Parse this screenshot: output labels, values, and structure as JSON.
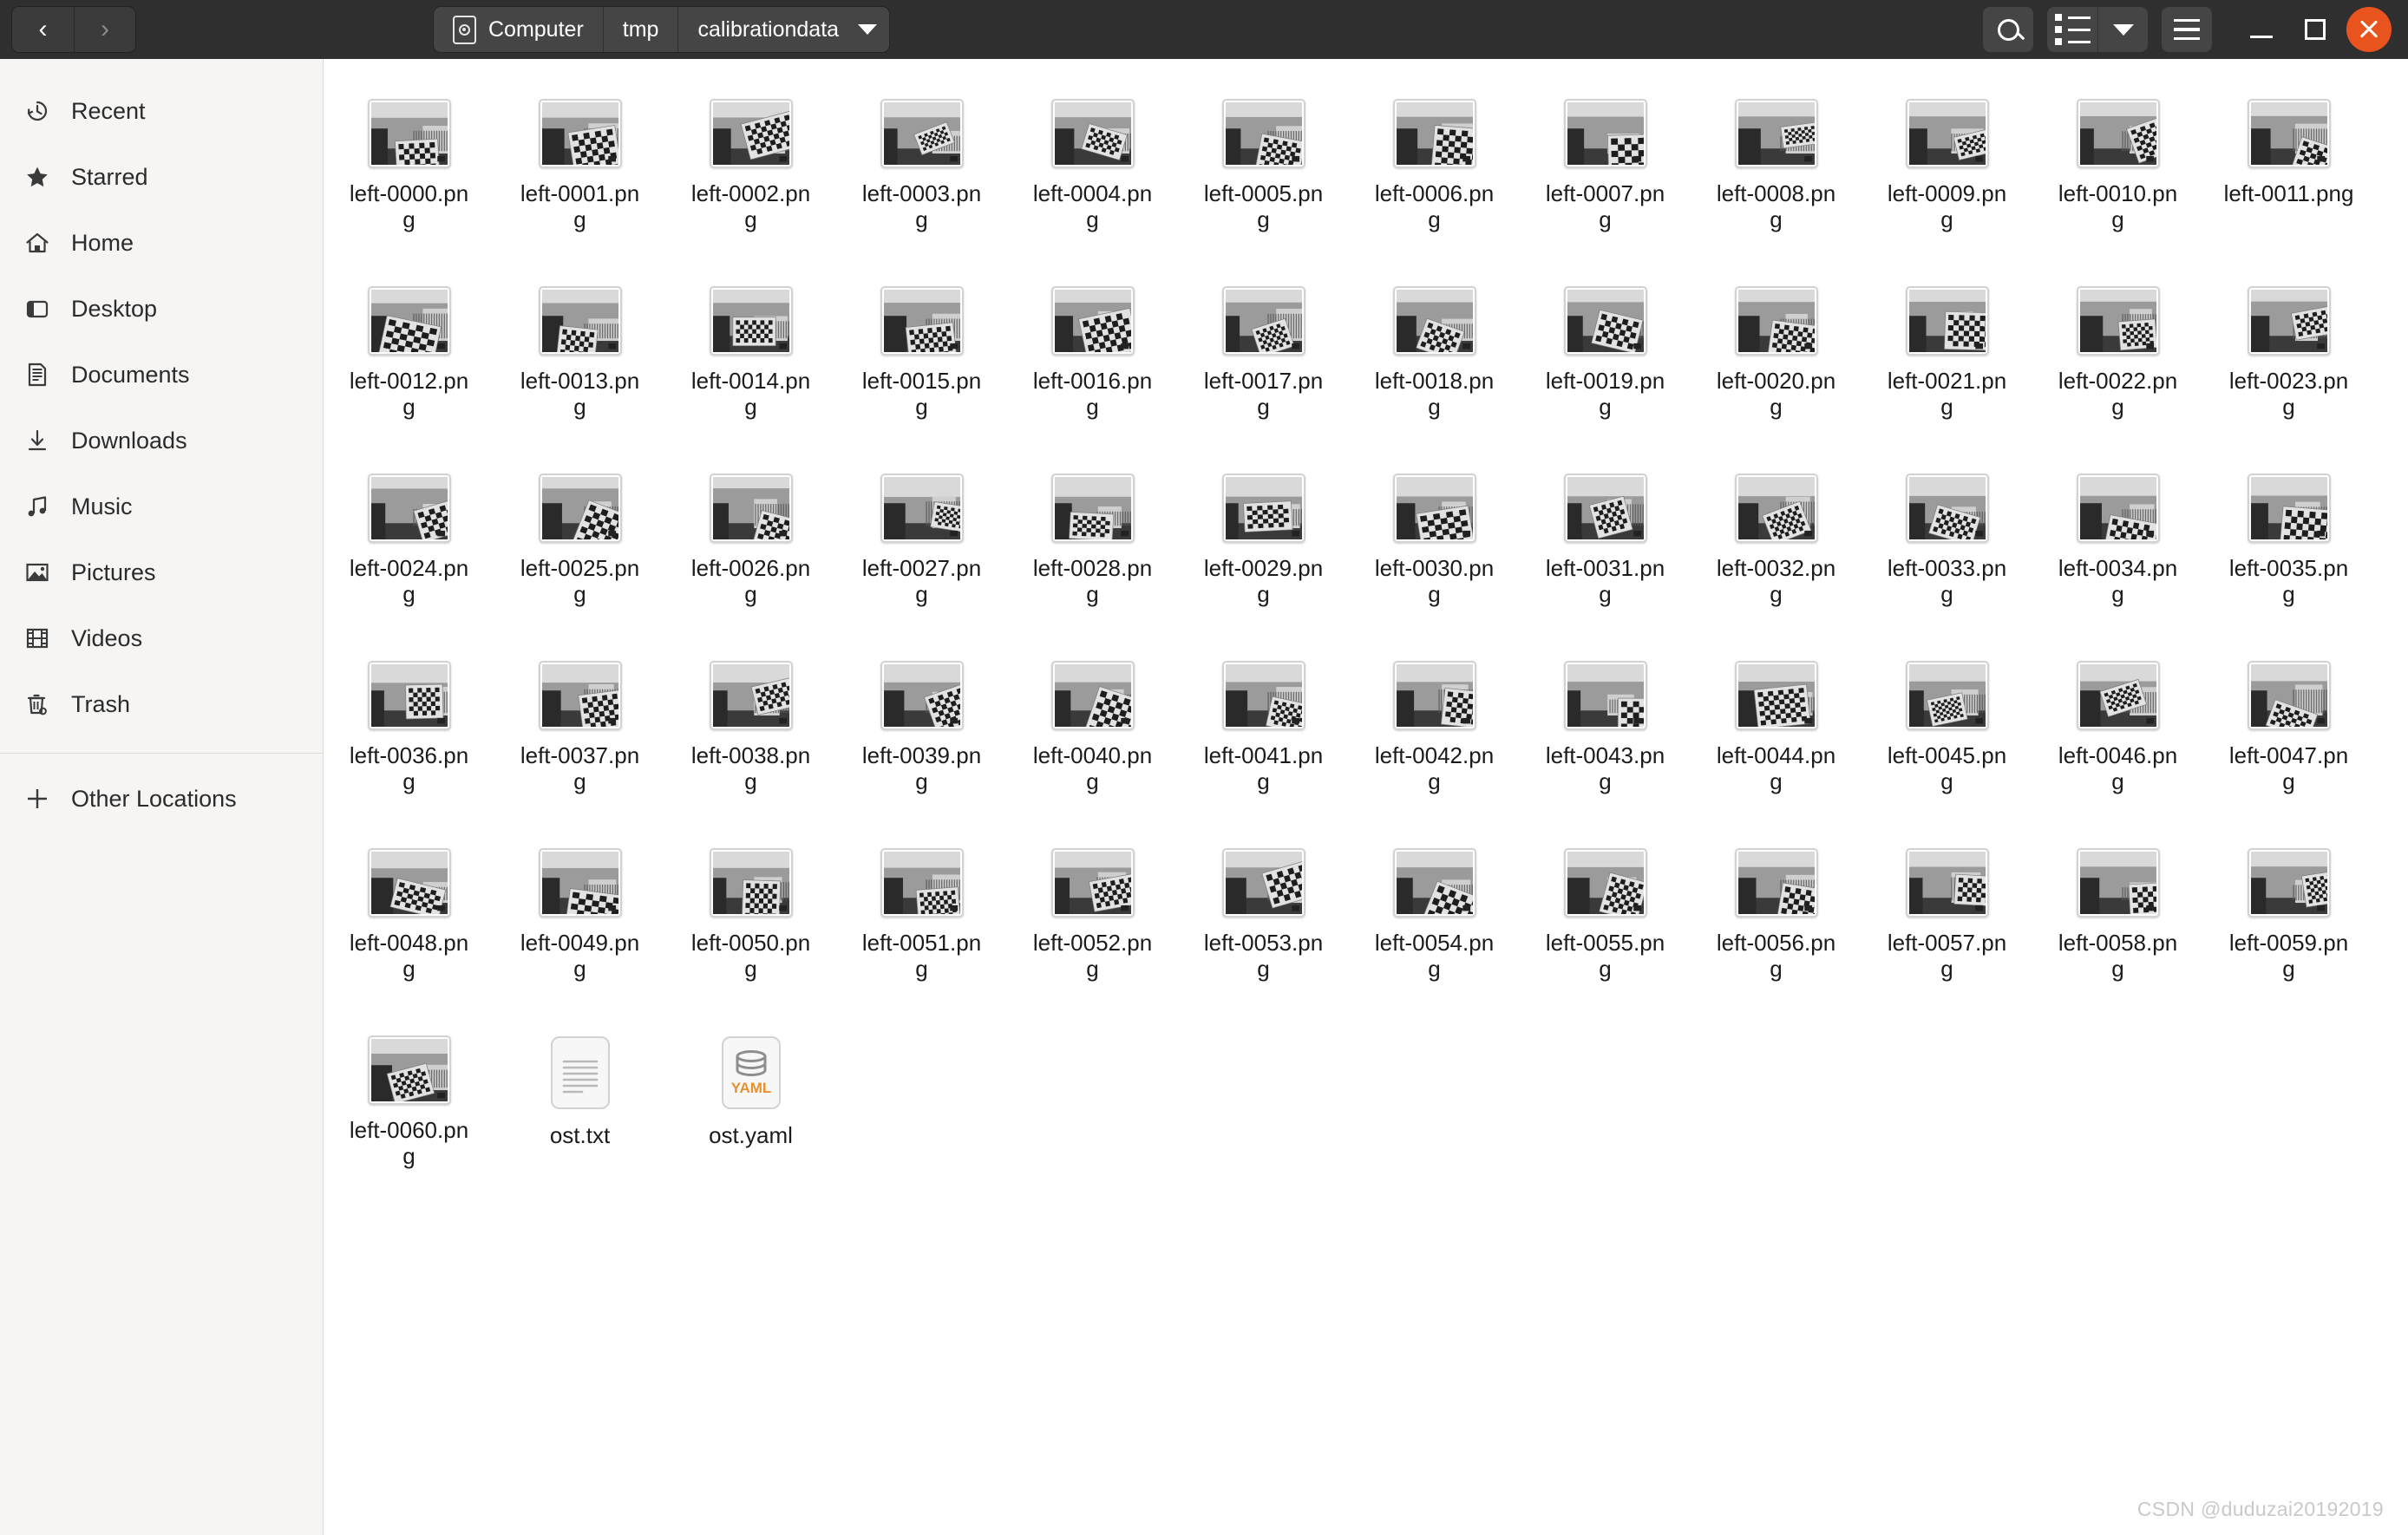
{
  "window": {
    "titlebar_bg": "#2f2f2f",
    "close_color": "#e9541e"
  },
  "header": {
    "nav": {
      "back_label": "‹",
      "back_name": "back-button",
      "forward_label": "›",
      "forward_name": "forward-button"
    },
    "breadcrumb": [
      {
        "label": "Computer",
        "icon": "disc-icon",
        "current": false
      },
      {
        "label": "tmp",
        "icon": "",
        "current": false
      },
      {
        "label": "calibrationdata",
        "icon": "",
        "current": true
      }
    ],
    "buttons": {
      "search": "search-icon",
      "view_list": "list-view-icon",
      "view_dropdown": "chevron-down-icon",
      "menu": "hamburger-menu-icon",
      "minimize": "minimize-icon",
      "maximize": "maximize-icon",
      "close": "close-icon"
    }
  },
  "sidebar": {
    "items": [
      {
        "label": "Recent",
        "icon": "clock-icon"
      },
      {
        "label": "Starred",
        "icon": "star-icon"
      },
      {
        "label": "Home",
        "icon": "home-icon"
      },
      {
        "label": "Desktop",
        "icon": "desktop-icon"
      },
      {
        "label": "Documents",
        "icon": "documents-icon"
      },
      {
        "label": "Downloads",
        "icon": "download-icon"
      },
      {
        "label": "Music",
        "icon": "music-note-icon"
      },
      {
        "label": "Pictures",
        "icon": "picture-icon"
      },
      {
        "label": "Videos",
        "icon": "film-icon"
      },
      {
        "label": "Trash",
        "icon": "trash-icon"
      }
    ],
    "other": {
      "label": "Other Locations",
      "icon": "plus-icon"
    }
  },
  "files": [
    {
      "name": "left-0000.png",
      "type": "image"
    },
    {
      "name": "left-0001.png",
      "type": "image"
    },
    {
      "name": "left-0002.png",
      "type": "image"
    },
    {
      "name": "left-0003.png",
      "type": "image"
    },
    {
      "name": "left-0004.png",
      "type": "image"
    },
    {
      "name": "left-0005.png",
      "type": "image"
    },
    {
      "name": "left-0006.png",
      "type": "image"
    },
    {
      "name": "left-0007.png",
      "type": "image"
    },
    {
      "name": "left-0008.png",
      "type": "image"
    },
    {
      "name": "left-0009.png",
      "type": "image"
    },
    {
      "name": "left-0010.png",
      "type": "image"
    },
    {
      "name": "left-0011.png",
      "type": "image"
    },
    {
      "name": "left-0012.png",
      "type": "image"
    },
    {
      "name": "left-0013.png",
      "type": "image"
    },
    {
      "name": "left-0014.png",
      "type": "image"
    },
    {
      "name": "left-0015.png",
      "type": "image"
    },
    {
      "name": "left-0016.png",
      "type": "image"
    },
    {
      "name": "left-0017.png",
      "type": "image"
    },
    {
      "name": "left-0018.png",
      "type": "image"
    },
    {
      "name": "left-0019.png",
      "type": "image"
    },
    {
      "name": "left-0020.png",
      "type": "image"
    },
    {
      "name": "left-0021.png",
      "type": "image"
    },
    {
      "name": "left-0022.png",
      "type": "image"
    },
    {
      "name": "left-0023.png",
      "type": "image"
    },
    {
      "name": "left-0024.png",
      "type": "image"
    },
    {
      "name": "left-0025.png",
      "type": "image"
    },
    {
      "name": "left-0026.png",
      "type": "image"
    },
    {
      "name": "left-0027.png",
      "type": "image"
    },
    {
      "name": "left-0028.png",
      "type": "image"
    },
    {
      "name": "left-0029.png",
      "type": "image"
    },
    {
      "name": "left-0030.png",
      "type": "image"
    },
    {
      "name": "left-0031.png",
      "type": "image"
    },
    {
      "name": "left-0032.png",
      "type": "image"
    },
    {
      "name": "left-0033.png",
      "type": "image"
    },
    {
      "name": "left-0034.png",
      "type": "image"
    },
    {
      "name": "left-0035.png",
      "type": "image"
    },
    {
      "name": "left-0036.png",
      "type": "image"
    },
    {
      "name": "left-0037.png",
      "type": "image"
    },
    {
      "name": "left-0038.png",
      "type": "image"
    },
    {
      "name": "left-0039.png",
      "type": "image"
    },
    {
      "name": "left-0040.png",
      "type": "image"
    },
    {
      "name": "left-0041.png",
      "type": "image"
    },
    {
      "name": "left-0042.png",
      "type": "image"
    },
    {
      "name": "left-0043.png",
      "type": "image"
    },
    {
      "name": "left-0044.png",
      "type": "image"
    },
    {
      "name": "left-0045.png",
      "type": "image"
    },
    {
      "name": "left-0046.png",
      "type": "image"
    },
    {
      "name": "left-0047.png",
      "type": "image"
    },
    {
      "name": "left-0048.png",
      "type": "image"
    },
    {
      "name": "left-0049.png",
      "type": "image"
    },
    {
      "name": "left-0050.png",
      "type": "image"
    },
    {
      "name": "left-0051.png",
      "type": "image"
    },
    {
      "name": "left-0052.png",
      "type": "image"
    },
    {
      "name": "left-0053.png",
      "type": "image"
    },
    {
      "name": "left-0054.png",
      "type": "image"
    },
    {
      "name": "left-0055.png",
      "type": "image"
    },
    {
      "name": "left-0056.png",
      "type": "image"
    },
    {
      "name": "left-0057.png",
      "type": "image"
    },
    {
      "name": "left-0058.png",
      "type": "image"
    },
    {
      "name": "left-0059.png",
      "type": "image"
    },
    {
      "name": "left-0060.png",
      "type": "image"
    },
    {
      "name": "ost.txt",
      "type": "text"
    },
    {
      "name": "ost.yaml",
      "type": "yaml"
    }
  ],
  "yaml_badge": "YAML",
  "watermark": "CSDN @duduzai20192019"
}
